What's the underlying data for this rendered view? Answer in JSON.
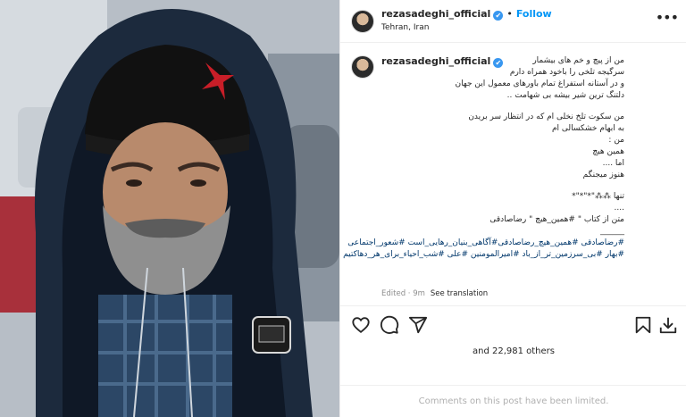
{
  "post": {
    "username": "rezasadeghi_official",
    "verified_mark": "✔",
    "follow_label": "Follow",
    "location": "Tehran, Iran",
    "more_icon": "ellipsis-icon"
  },
  "caption": {
    "username": "rezasadeghi_official",
    "lines": [
      "من از پیچ و خم های بیشمار",
      "سرگیجه تلخی را باخود همراه دارم",
      "و در آستانه استفراغ تمام باورهای معمول این جهان",
      "دلتنگ ترین شیر بیشه بی شهامت ..",
      "",
      "من سکوت تلخ نخلی ام که در انتظار سر بریدن",
      "به ابهام خشکسالی ام",
      "من :",
      "همین هیچ",
      "اما ....",
      "هنوز میجنگم",
      "",
      "تنها ⁂⁂\"*\"*\"*",
      "....",
      "متن از کتاب \" #همین_هیچ \" رضاصادقی",
      "______",
      "#رضاصادقی #همین_هیچ_رضاصادقی#آگاهی_بنیان_رهایی_است #شعور_اجتماعی",
      "#بهار #بی_سرزمین_تر_از_باد #امیرالمومنین #علی #شب_احیاء_برای_هر_دهاکتیم"
    ],
    "edited": "Edited · 9m",
    "see_translation": "See translation"
  },
  "actions": {
    "like_icon": "heart-icon",
    "comment_icon": "comment-icon",
    "share_icon": "send-icon",
    "save_icon": "bookmark-icon",
    "download_icon": "download-icon"
  },
  "likes_text": "and 22,981 others",
  "comments_limited": "Comments on this post have been limited.",
  "colors": {
    "link": "#0095f6",
    "hashtag": "#00376b",
    "muted": "#8e8e8e"
  }
}
